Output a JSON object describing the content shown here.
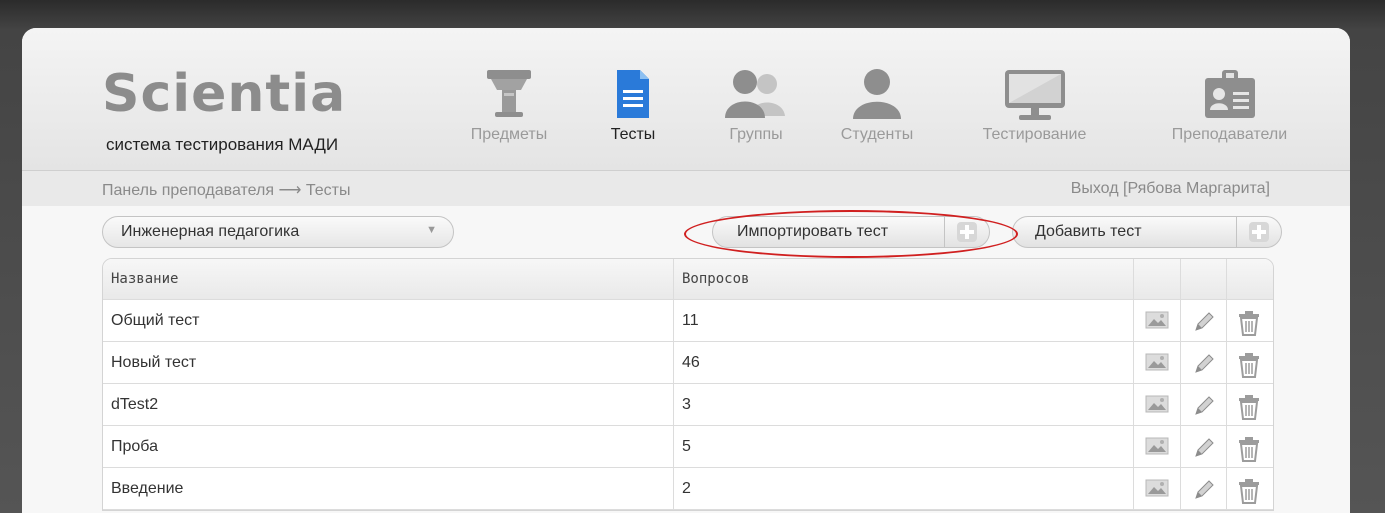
{
  "app": {
    "logo_title": "Scientia",
    "logo_subtitle": "система тестирования МАДИ"
  },
  "nav": {
    "items": [
      {
        "label": "Предметы",
        "icon": "lectern-icon",
        "active": false
      },
      {
        "label": "Тесты",
        "icon": "document-icon",
        "active": true
      },
      {
        "label": "Группы",
        "icon": "group-icon",
        "active": false
      },
      {
        "label": "Студенты",
        "icon": "user-icon",
        "active": false
      },
      {
        "label": "Тестирование",
        "icon": "monitor-icon",
        "active": false
      },
      {
        "label": "Преподаватели",
        "icon": "id-badge-icon",
        "active": false
      }
    ],
    "active_color": "#2a7ad9",
    "inactive_icon_color": "#9b9b9b"
  },
  "breadcrumb": "Панель преподавателя ⟶ Тесты",
  "logout": "Выход [Рябова Маргарита]",
  "toolbar": {
    "subject_selected": "Инженерная педагогика",
    "import_label": "Импортировать тест",
    "add_label": "Добавить тест",
    "highlight_color": "#d02020"
  },
  "table": {
    "columns": [
      "Название",
      "Вопросов"
    ],
    "rows": [
      {
        "name": "Общий тест",
        "questions": "11"
      },
      {
        "name": "Новый тест",
        "questions": "46"
      },
      {
        "name": "dTest2",
        "questions": "3"
      },
      {
        "name": "Проба",
        "questions": "5"
      },
      {
        "name": "Введение",
        "questions": "2"
      }
    ],
    "row_actions": [
      "image-icon",
      "pencil-icon",
      "trash-icon"
    ]
  }
}
